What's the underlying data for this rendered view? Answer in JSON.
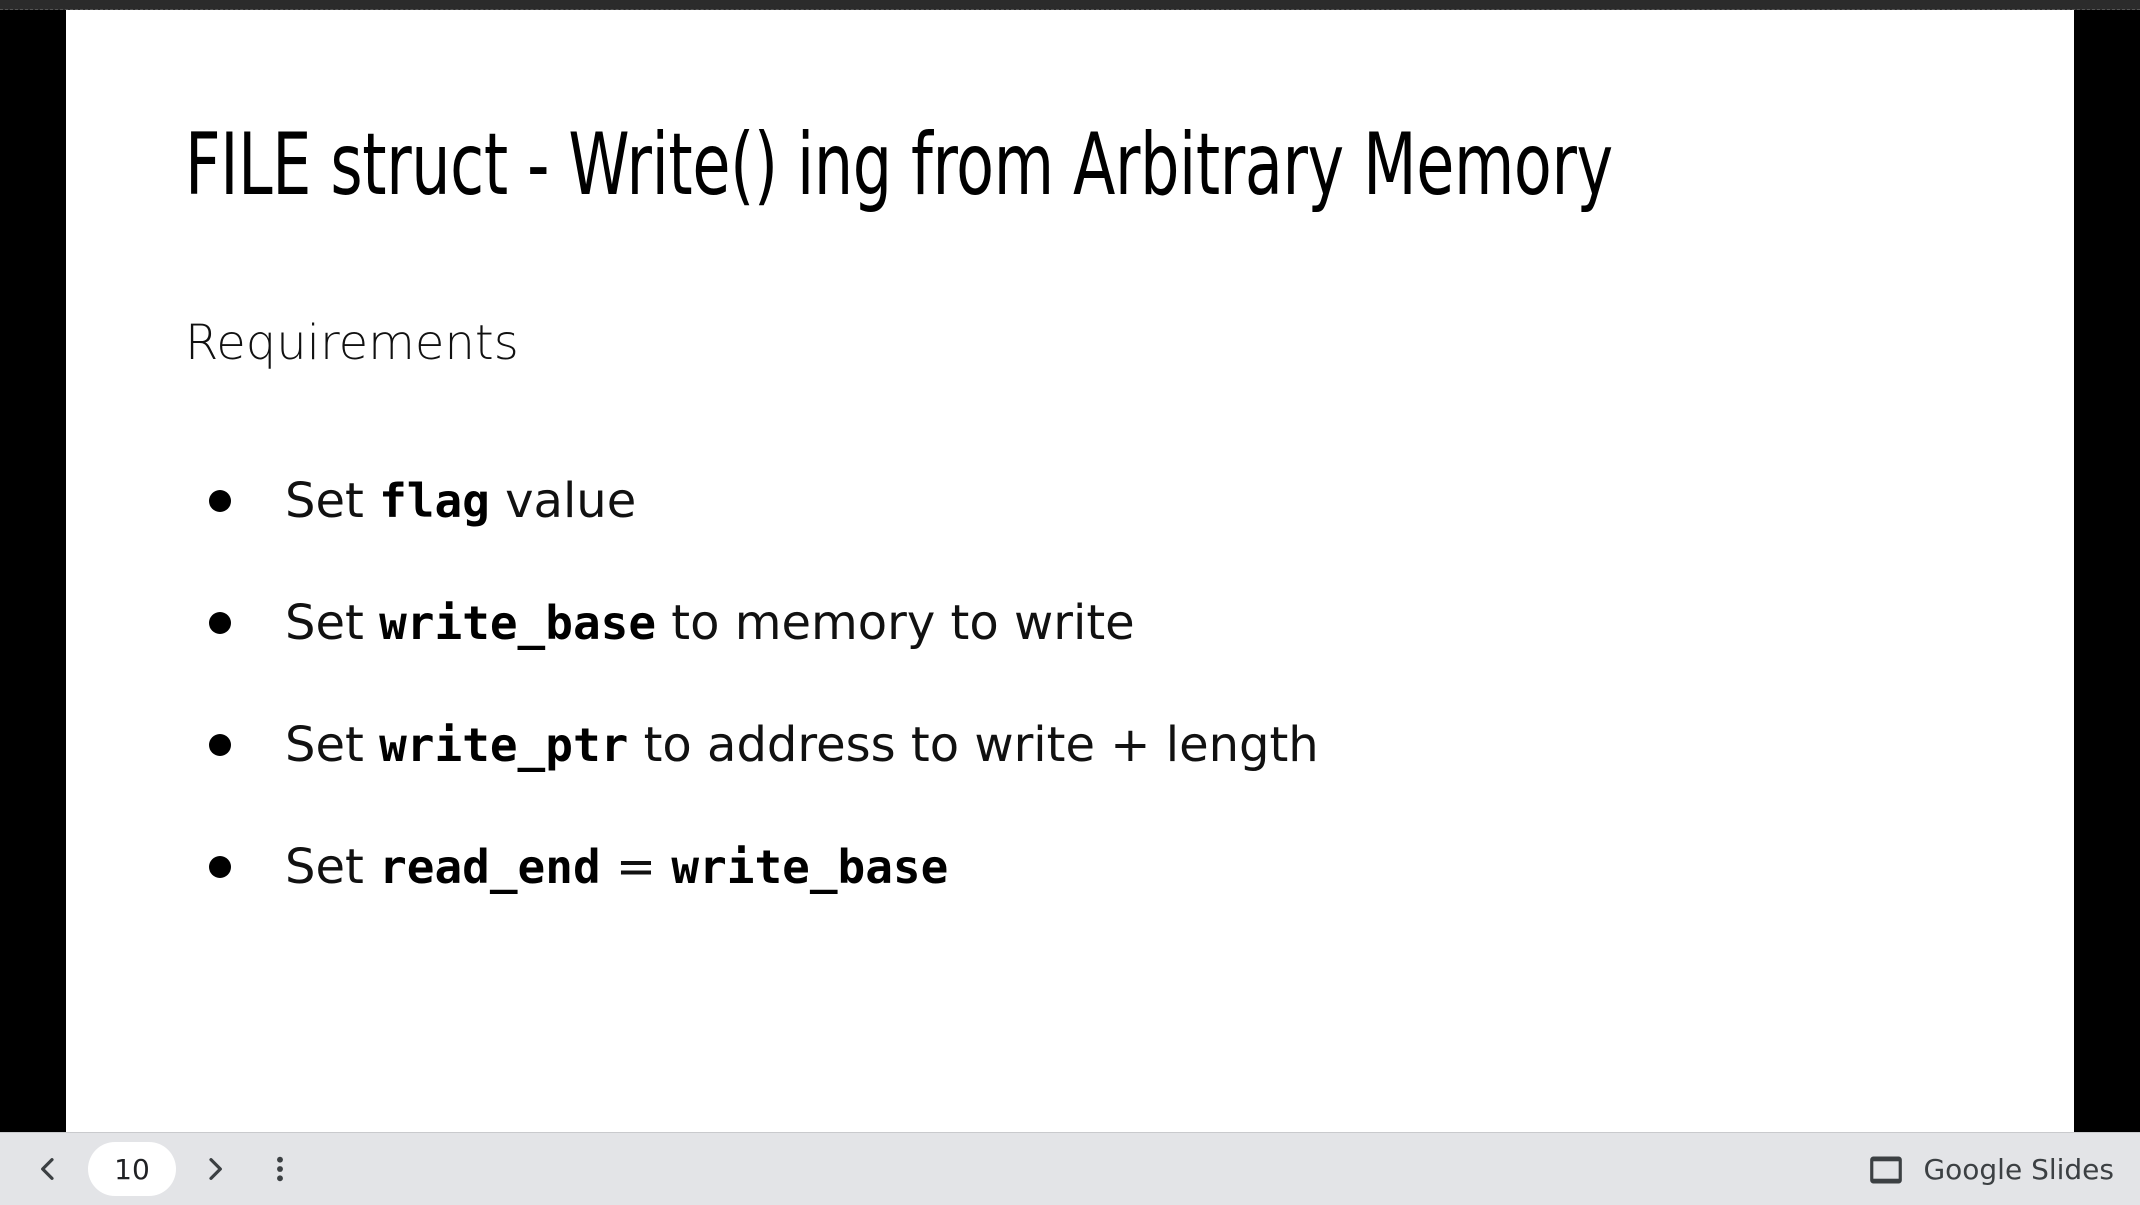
{
  "slide": {
    "title": "FILE struct - Write() ing from Arbitrary Memory",
    "subtitle": "Requirements",
    "bullets": [
      {
        "parts": [
          {
            "text": "Set ",
            "code": false
          },
          {
            "text": "flag",
            "code": true
          },
          {
            "text": " value",
            "code": false
          }
        ]
      },
      {
        "parts": [
          {
            "text": "Set ",
            "code": false
          },
          {
            "text": "write_base",
            "code": true
          },
          {
            "text": " to memory to write",
            "code": false
          }
        ]
      },
      {
        "parts": [
          {
            "text": "Set ",
            "code": false
          },
          {
            "text": "write_ptr",
            "code": true
          },
          {
            "text": " to address to write + length",
            "code": false
          }
        ]
      },
      {
        "parts": [
          {
            "text": "Set ",
            "code": false
          },
          {
            "text": "read_end",
            "code": true
          },
          {
            "text": " = ",
            "code": false
          },
          {
            "text": "write_base",
            "code": true
          }
        ]
      }
    ]
  },
  "toolbar": {
    "page_number": "10",
    "prev_icon": "chevron-left-icon",
    "next_icon": "chevron-right-icon",
    "more_icon": "more-vert-icon",
    "brand_icon": "slides-icon",
    "brand_label": "Google Slides"
  }
}
